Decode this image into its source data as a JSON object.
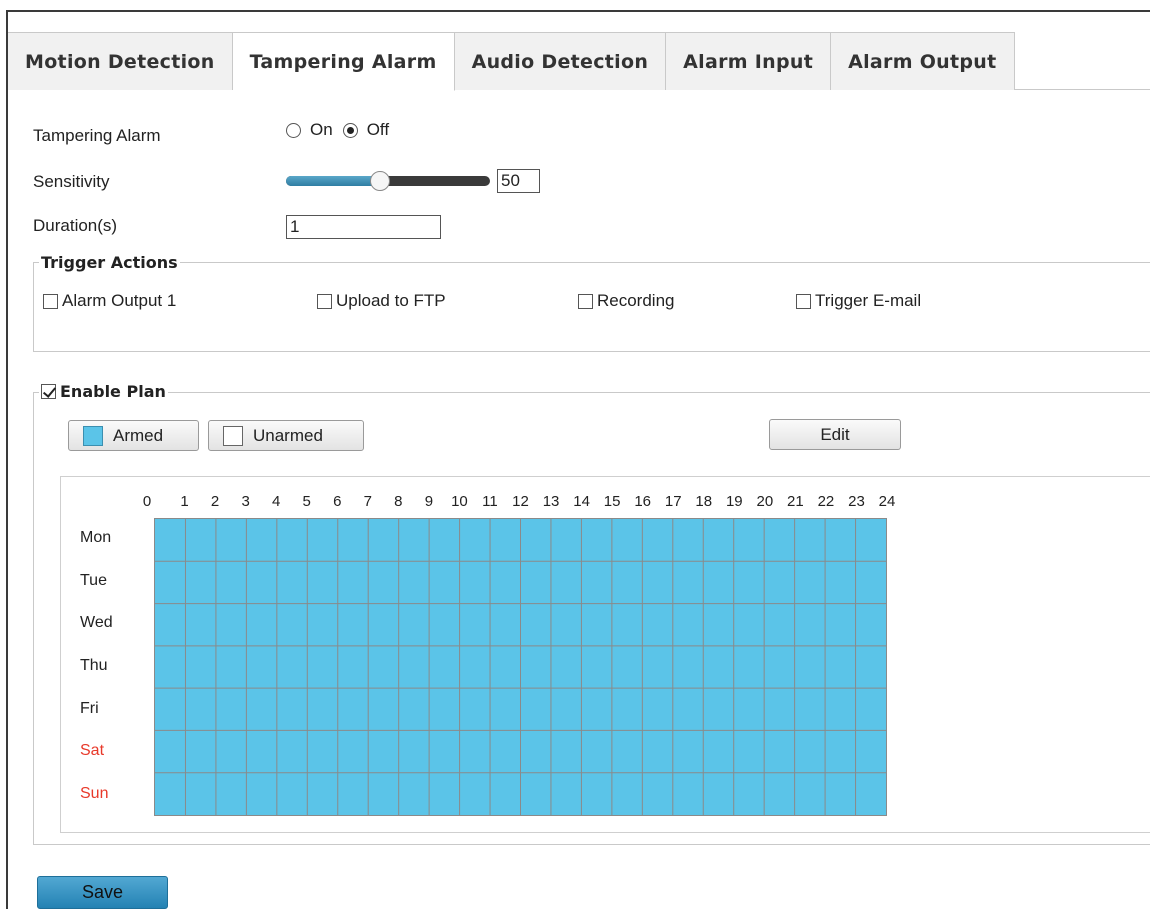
{
  "tabs": [
    {
      "label": "Motion Detection",
      "active": false
    },
    {
      "label": "Tampering Alarm",
      "active": true
    },
    {
      "label": "Audio Detection",
      "active": false
    },
    {
      "label": "Alarm Input",
      "active": false
    },
    {
      "label": "Alarm Output",
      "active": false
    }
  ],
  "tampering_alarm": {
    "label": "Tampering Alarm",
    "on_label": "On",
    "off_label": "Off",
    "selected": "Off"
  },
  "sensitivity": {
    "label": "Sensitivity",
    "value": "50",
    "level_percent": 50
  },
  "duration": {
    "label": "Duration(s)",
    "value": "1"
  },
  "trigger_actions": {
    "legend": "Trigger Actions",
    "items": [
      {
        "label": "Alarm Output 1",
        "checked": false
      },
      {
        "label": "Upload to FTP",
        "checked": false
      },
      {
        "label": "Recording",
        "checked": false
      },
      {
        "label": "Trigger E-mail",
        "checked": false
      }
    ]
  },
  "plan": {
    "enable_label": "Enable Plan",
    "enabled": true,
    "armed_label": "Armed",
    "unarmed_label": "Unarmed",
    "edit_label": "Edit",
    "armed_color": "#5bc4e8",
    "hours": [
      "0",
      "1",
      "2",
      "3",
      "4",
      "5",
      "6",
      "7",
      "8",
      "9",
      "10",
      "11",
      "12",
      "13",
      "14",
      "15",
      "16",
      "17",
      "18",
      "19",
      "20",
      "21",
      "22",
      "23",
      "24"
    ],
    "days": [
      "Mon",
      "Tue",
      "Wed",
      "Thu",
      "Fri",
      "Sat",
      "Sun"
    ],
    "weekend_color": "#e8392a",
    "schedule": "all-armed"
  },
  "save_label": "Save"
}
